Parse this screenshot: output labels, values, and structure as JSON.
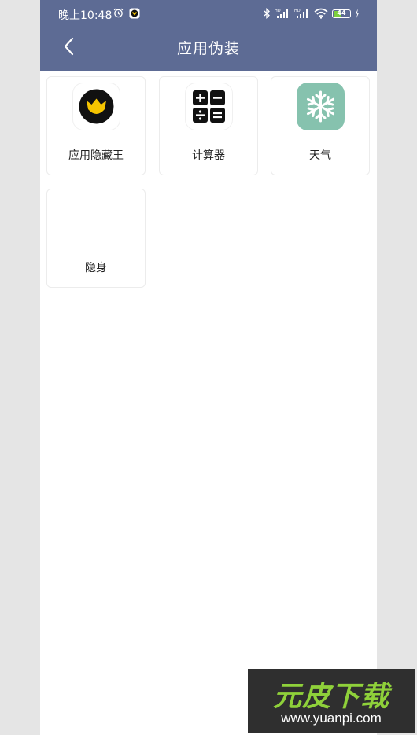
{
  "status_bar": {
    "time": "晚上10:48",
    "battery_level": "44"
  },
  "header": {
    "title": "应用伪装"
  },
  "apps": [
    {
      "label": "应用隐藏王",
      "icon": "crown-logo-icon"
    },
    {
      "label": "计算器",
      "icon": "calculator-icon"
    },
    {
      "label": "天气",
      "icon": "snowflake-icon"
    },
    {
      "label": "隐身",
      "icon": "blank-icon"
    }
  ],
  "watermark": {
    "brand": "元皮下载",
    "url": "www.yuanpi.com"
  },
  "colors": {
    "header_bg": "#5d6b94",
    "weather_icon_bg": "#86c2ae",
    "battery_fill": "#7ccf3e",
    "watermark_green": "#8fd13a"
  }
}
